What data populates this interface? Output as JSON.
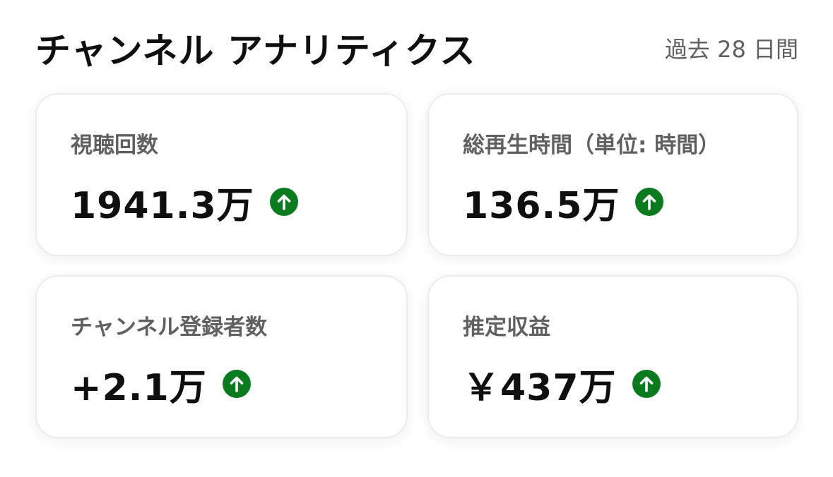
{
  "header": {
    "title": "チャンネル アナリティクス",
    "period": "過去 28 日間"
  },
  "metrics": [
    {
      "label": "視聴回数",
      "value": "1941.3万",
      "trend_icon": "arrow-up-circle-icon"
    },
    {
      "label": "総再生時間（単位: 時間）",
      "value": "136.5万",
      "trend_icon": "arrow-up-circle-icon"
    },
    {
      "label": "チャンネル登録者数",
      "value": "+2.1万",
      "trend_icon": "arrow-up-circle-icon"
    },
    {
      "label": "推定収益",
      "value": "￥437万",
      "trend_icon": "arrow-up-circle-icon"
    }
  ],
  "colors": {
    "trend_up": "#0a7a1f",
    "label": "#606060",
    "value": "#0f0f0f"
  }
}
